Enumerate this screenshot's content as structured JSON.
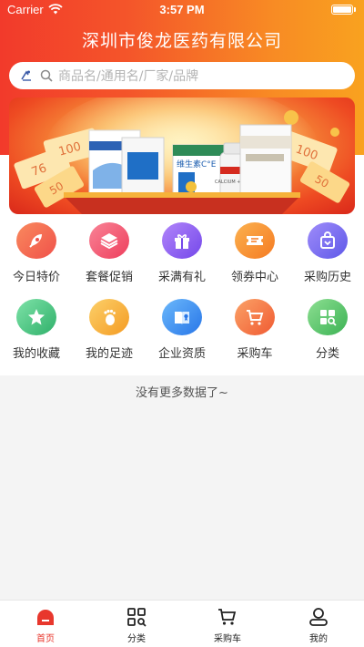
{
  "status_bar": {
    "carrier": "Carrier",
    "time": "3:57 PM"
  },
  "header": {
    "title": "深圳市俊龙医药有限公司"
  },
  "search": {
    "placeholder": "商品名/通用名/厂家/品牌"
  },
  "banner": {
    "products": [
      {
        "text": ""
      },
      {
        "text": "维生素C°E"
      },
      {
        "text": "CALCIUM + VITAMIN D"
      }
    ],
    "coupons": [
      {
        "text": "100"
      },
      {
        "text": "50"
      },
      {
        "text": "76"
      }
    ]
  },
  "menu": [
    {
      "label": "今日特价",
      "icon": "rocket-icon",
      "color": "#f46a4d"
    },
    {
      "label": "套餐促销",
      "icon": "layers-icon",
      "color": "#f4576a"
    },
    {
      "label": "采满有礼",
      "icon": "gift-icon",
      "color": "#8e5cf2"
    },
    {
      "label": "领券中心",
      "icon": "ticket-icon",
      "color": "#f7932e"
    },
    {
      "label": "采购历史",
      "icon": "bag-icon",
      "color": "#7b6cf0"
    },
    {
      "label": "我的收藏",
      "icon": "star-icon",
      "color": "#4ec58a"
    },
    {
      "label": "我的足迹",
      "icon": "footprint-icon",
      "color": "#f6b23a"
    },
    {
      "label": "企业资质",
      "icon": "certificate-icon",
      "color": "#3b8ef2"
    },
    {
      "label": "采购车",
      "icon": "cart-icon",
      "color": "#f47a3b"
    },
    {
      "label": "分类",
      "icon": "category-icon",
      "color": "#4bbf6a"
    }
  ],
  "list_end_text": "没有更多数据了~",
  "tabs": [
    {
      "label": "首页",
      "icon": "home-icon",
      "active": true
    },
    {
      "label": "分类",
      "icon": "grid-search-icon",
      "active": false
    },
    {
      "label": "采购车",
      "icon": "cart-icon",
      "active": false
    },
    {
      "label": "我的",
      "icon": "user-icon",
      "active": false
    }
  ],
  "colors": {
    "accent": "#e8372d",
    "header_start": "#f23a2b",
    "header_end": "#f9a21f"
  }
}
